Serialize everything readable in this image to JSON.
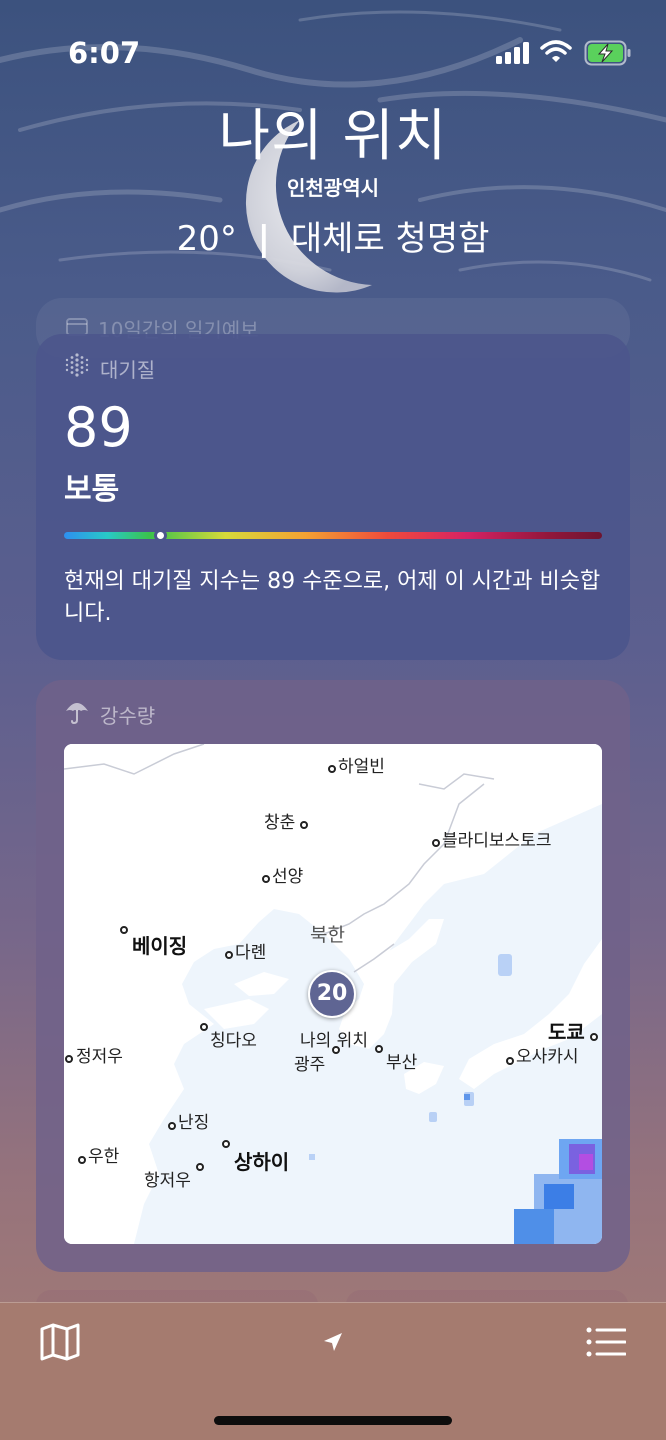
{
  "status_bar": {
    "time": "6:07"
  },
  "header": {
    "title": "나의 위치",
    "subtitle": "인천광역시",
    "temperature": "20°",
    "separator": "|",
    "condition": "대체로 청명함"
  },
  "forecast_card": {
    "label": "10일간의 일기예보",
    "icon": "calendar-icon"
  },
  "air_quality": {
    "label": "대기질",
    "icon": "air-quality-icon",
    "value": "89",
    "level": "보통",
    "level_fraction": 0.18,
    "description": "현재의 대기질 지수는 89 수준으로, 어제 이 시간과 비슷합니다."
  },
  "precipitation": {
    "label": "강수량",
    "icon": "umbrella-icon",
    "map": {
      "pin_temp": "20",
      "country": "북한",
      "my_location": "나의 위치",
      "cities": {
        "harbin": "하얼빈",
        "changchun": "창춘",
        "vladivostok": "블라디보스토크",
        "shenyang": "선양",
        "beijing": "베이징",
        "dalian": "다롄",
        "qingdao": "칭다오",
        "zhengzhou": "정저우",
        "gwangju": "광주",
        "busan": "부산",
        "tokyo": "도쿄",
        "osaka": "오사카시",
        "nanjing": "난징",
        "wuhan": "우한",
        "shanghai": "상하이",
        "hangzhou": "항저우"
      }
    }
  },
  "tabbar": {
    "left": "map-icon",
    "center": "location-arrow-icon",
    "right": "list-icon"
  },
  "colors": {
    "aq_card": "#4c568c",
    "precip_card": "#70628a",
    "tabbar": "#a57b6f"
  }
}
